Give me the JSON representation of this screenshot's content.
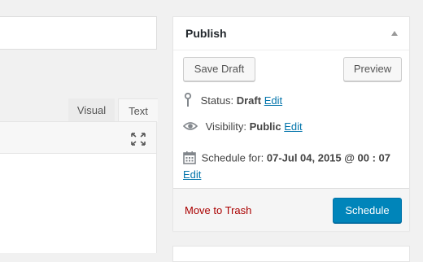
{
  "editor": {
    "tabs": [
      {
        "label": "Visual"
      },
      {
        "label": "Text"
      }
    ],
    "fullscreen_icon": "fullscreen-expand-icon"
  },
  "publish": {
    "title": "Publish",
    "toggle_icon": "collapse-arrow-icon",
    "save_draft_label": "Save Draft",
    "preview_label": "Preview",
    "status": {
      "icon": "pin-icon",
      "label": "Status:",
      "value": "Draft",
      "edit_label": "Edit"
    },
    "visibility": {
      "icon": "eye-icon",
      "label": "Visibility:",
      "value": "Public",
      "edit_label": "Edit"
    },
    "schedule": {
      "icon": "calendar-icon",
      "label": "Schedule for:",
      "value": "07-Jul 04, 2015 @ 00 : 07",
      "edit_label": "Edit"
    },
    "trash_label": "Move to Trash",
    "schedule_button_label": "Schedule"
  },
  "colors": {
    "primary_button": "#0085ba",
    "link": "#0073aa",
    "trash": "#aa0000",
    "background": "#f1f1f1"
  }
}
